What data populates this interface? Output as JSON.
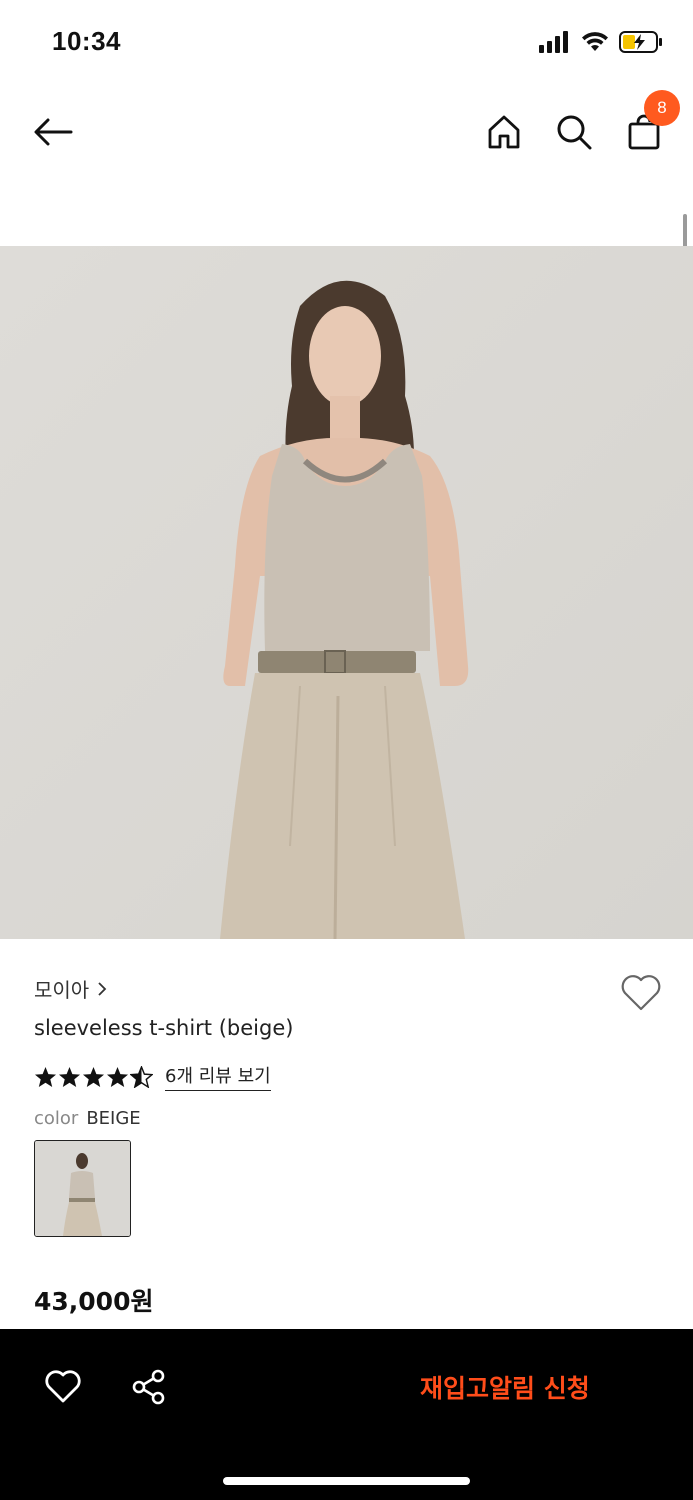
{
  "status_bar": {
    "time": "10:34"
  },
  "nav": {
    "cart_count": "8"
  },
  "product": {
    "brand": "모이아",
    "name": "sleeveless t-shirt (beige)",
    "rating": 4.5,
    "review_link": "6개 리뷰 보기",
    "color_label": "color",
    "color_value": "BEIGE",
    "price": "43,000원"
  },
  "bottom_bar": {
    "restock_label": "재입고알림 신청"
  },
  "colors": {
    "accent": "#ff5a1f",
    "restock_text": "#ff4d1a",
    "bottom_bar_bg": "#000000"
  }
}
